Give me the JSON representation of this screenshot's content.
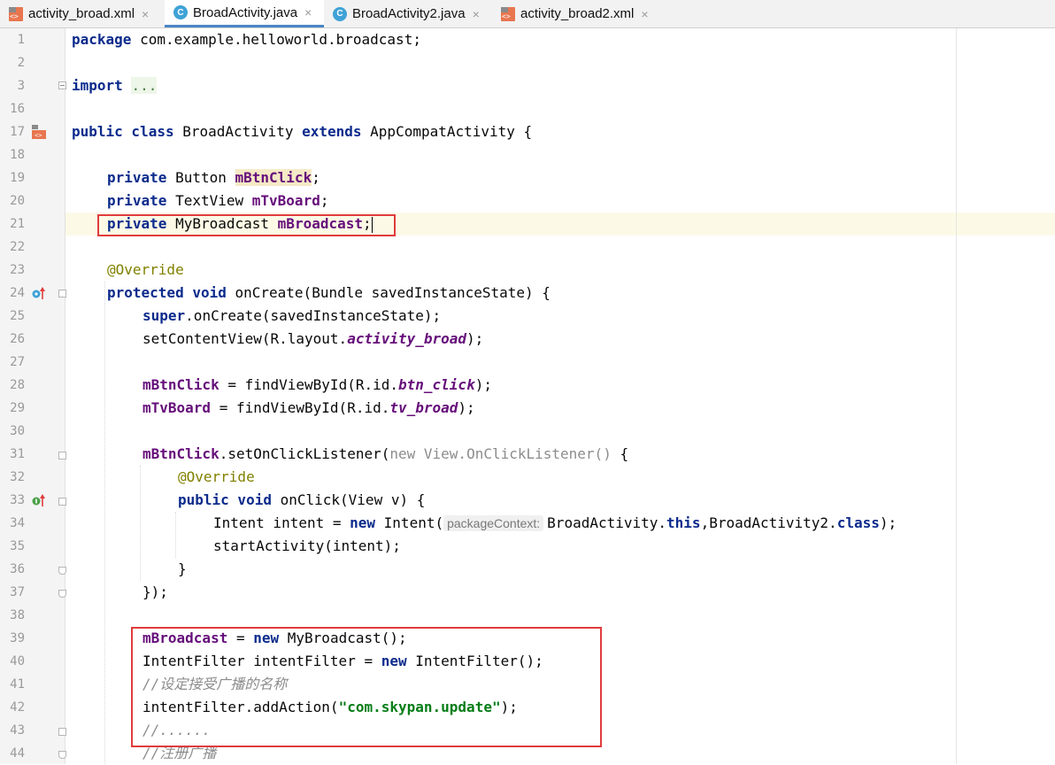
{
  "tabs": [
    {
      "label": "activity_broad.xml",
      "icon": "xml-file-icon",
      "active": false
    },
    {
      "label": "BroadActivity.java",
      "icon": "java-class-icon",
      "active": true
    },
    {
      "label": "BroadActivity2.java",
      "icon": "java-class-icon",
      "active": false
    },
    {
      "label": "activity_broad2.xml",
      "icon": "xml-file-icon",
      "active": false
    }
  ],
  "close_glyph": "×",
  "line_numbers": [
    "1",
    "2",
    "3",
    "16",
    "17",
    "18",
    "19",
    "20",
    "21",
    "22",
    "23",
    "24",
    "25",
    "26",
    "27",
    "28",
    "29",
    "30",
    "31",
    "32",
    "33",
    "34",
    "35",
    "36",
    "37",
    "38",
    "39",
    "40",
    "41",
    "42",
    "43",
    "44"
  ],
  "code": {
    "l1": [
      "package",
      " com.example.helloworld.broadcast;"
    ],
    "l3": [
      "import",
      " ",
      "..."
    ],
    "l17": [
      "public class",
      " BroadActivity ",
      "extends",
      " AppCompatActivity {"
    ],
    "l19": [
      "private",
      " Button ",
      "mBtnClick",
      ";"
    ],
    "l20": [
      "private",
      " TextView ",
      "mTvBoard",
      ";"
    ],
    "l21": [
      "private",
      " MyBroadcast ",
      "mBroadcast",
      ";"
    ],
    "l23": [
      "@Override"
    ],
    "l24": [
      "protected void",
      " onCreate(Bundle savedInstanceState) {"
    ],
    "l25": [
      "super",
      ".onCreate(savedInstanceState);"
    ],
    "l26": [
      "setContentView(R.layout.",
      "activity_broad",
      ");"
    ],
    "l28": [
      "mBtnClick",
      " = findViewById(R.id.",
      "btn_click",
      ");"
    ],
    "l29": [
      "mTvBoard",
      " = findViewById(R.id.",
      "tv_broad",
      ");"
    ],
    "l31": [
      "mBtnClick",
      ".setOnClickListener(",
      "new",
      " View.OnClickListener()",
      " {"
    ],
    "l32": [
      "@Override"
    ],
    "l33": [
      "public void",
      " onClick(View v) {"
    ],
    "l34": [
      "Intent intent = ",
      "new",
      " Intent(",
      "packageContext:",
      "BroadActivity.",
      "this",
      ",BroadActivity2.",
      "class",
      ");"
    ],
    "l35": [
      "startActivity(intent);"
    ],
    "l36": [
      "}"
    ],
    "l37": [
      "});"
    ],
    "l39": [
      "mBroadcast",
      " = ",
      "new",
      " MyBroadcast();"
    ],
    "l40": [
      "IntentFilter intentFilter = ",
      "new",
      " IntentFilter();"
    ],
    "l41": [
      "//设定接受广播的名称"
    ],
    "l42": [
      "intentFilter.addAction(",
      "\"com.skypan.update\"",
      ");"
    ],
    "l43": [
      "//......"
    ],
    "l44": [
      "//注册广播"
    ]
  },
  "colors": {
    "keyword": "#0b2b8c",
    "field": "#660e7a",
    "annotation": "#808000",
    "comment": "#8c8c8c",
    "string": "#067d17",
    "highlight_box": "#e03c3c",
    "active_tab_underline": "#4a86c7"
  }
}
